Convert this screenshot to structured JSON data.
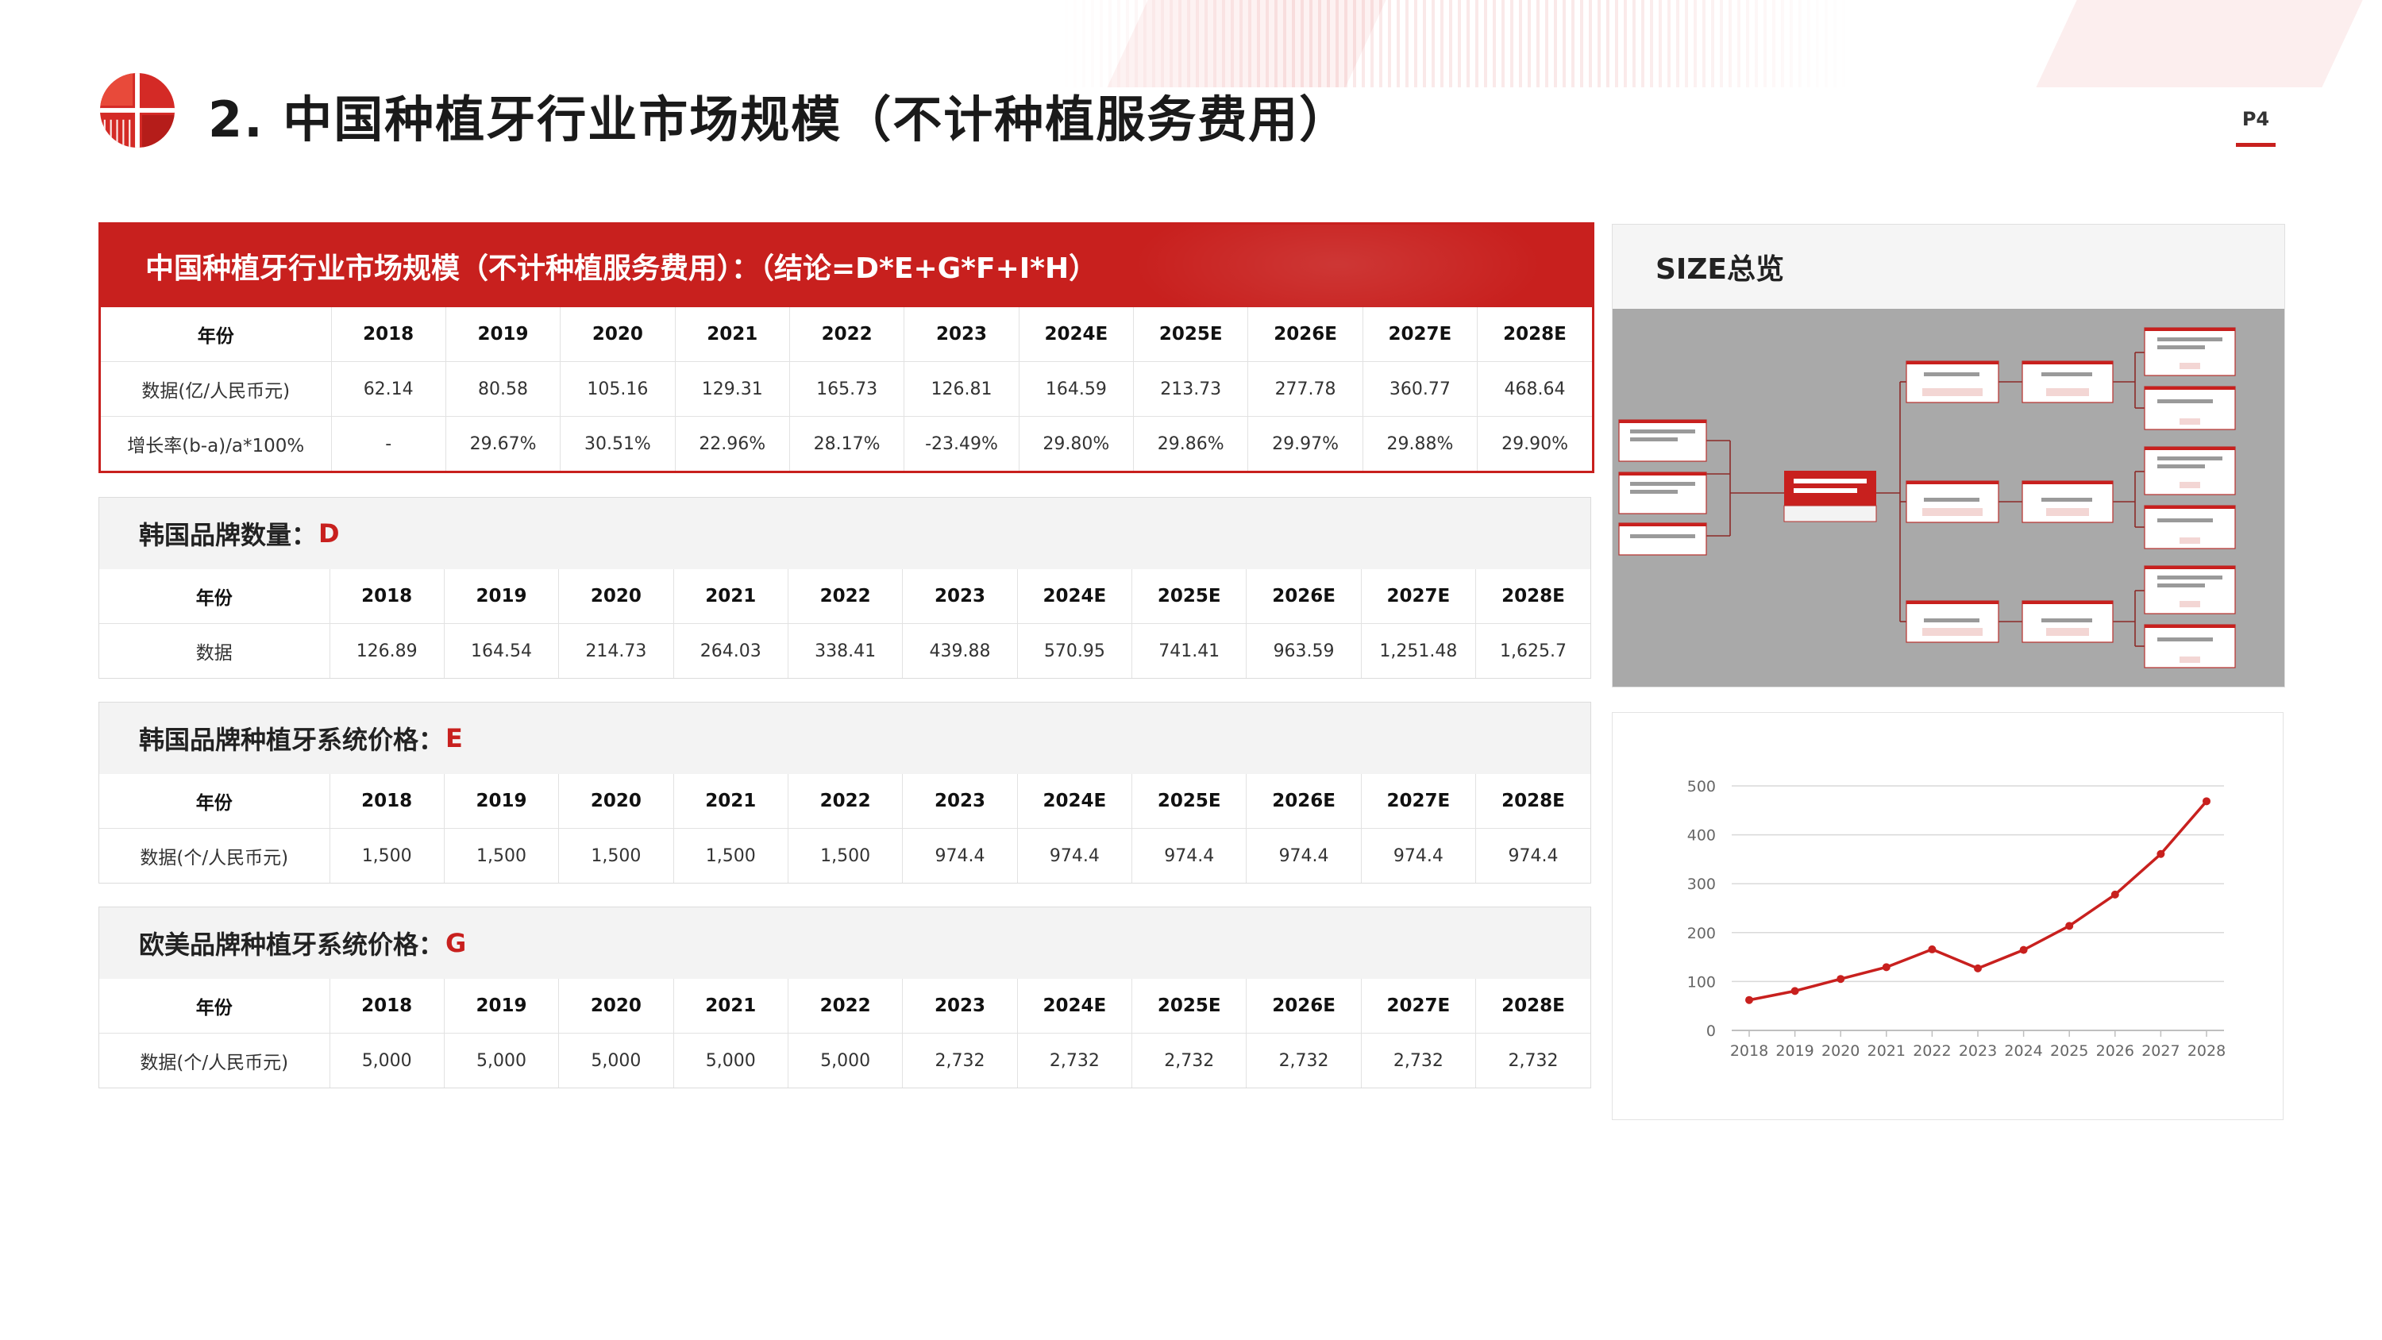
{
  "header": {
    "title": "2.  中国种植牙行业市场规模（不计种植服务费用）",
    "page_number": "P4"
  },
  "logo": {
    "name": "company-logo-icon",
    "color": "#d42a26"
  },
  "colors": {
    "accent": "#c8201e",
    "header_gray": "#f3f3f3",
    "diagram_bg": "#a9a9a9"
  },
  "main_table": {
    "title": "中国种植牙行业市场规模（不计种植服务费用）：（结论=D*E+G*F+I*H）",
    "header": [
      "年份",
      "2018",
      "2019",
      "2020",
      "2021",
      "2022",
      "2023",
      "2024E",
      "2025E",
      "2026E",
      "2027E",
      "2028E"
    ],
    "rows": [
      [
        "数据(亿/人民币元)",
        "62.14",
        "80.58",
        "105.16",
        "129.31",
        "165.73",
        "126.81",
        "164.59",
        "213.73",
        "277.78",
        "360.77",
        "468.64"
      ],
      [
        "增长率(b-a)/a*100%",
        "-",
        "29.67%",
        "30.51%",
        "22.96%",
        "28.17%",
        "-23.49%",
        "29.80%",
        "29.86%",
        "29.97%",
        "29.88%",
        "29.90%"
      ]
    ]
  },
  "sections": [
    {
      "title": "韩国品牌数量：",
      "var": "D",
      "header": [
        "年份",
        "2018",
        "2019",
        "2020",
        "2021",
        "2022",
        "2023",
        "2024E",
        "2025E",
        "2026E",
        "2027E",
        "2028E"
      ],
      "rows": [
        [
          "数据",
          "126.89",
          "164.54",
          "214.73",
          "264.03",
          "338.41",
          "439.88",
          "570.95",
          "741.41",
          "963.59",
          "1,251.48",
          "1,625.7"
        ]
      ]
    },
    {
      "title": "韩国品牌种植牙系统价格：",
      "var": "E",
      "header": [
        "年份",
        "2018",
        "2019",
        "2020",
        "2021",
        "2022",
        "2023",
        "2024E",
        "2025E",
        "2026E",
        "2027E",
        "2028E"
      ],
      "rows": [
        [
          "数据(个/人民币元)",
          "1,500",
          "1,500",
          "1,500",
          "1,500",
          "1,500",
          "974.4",
          "974.4",
          "974.4",
          "974.4",
          "974.4",
          "974.4"
        ]
      ]
    },
    {
      "title": "欧美品牌种植牙系统价格：",
      "var": "G",
      "header": [
        "年份",
        "2018",
        "2019",
        "2020",
        "2021",
        "2022",
        "2023",
        "2024E",
        "2025E",
        "2026E",
        "2027E",
        "2028E"
      ],
      "rows": [
        [
          "数据(个/人民币元)",
          "5,000",
          "5,000",
          "5,000",
          "5,000",
          "5,000",
          "2,732",
          "2,732",
          "2,732",
          "2,732",
          "2,732",
          "2,732"
        ]
      ]
    }
  ],
  "size_panel": {
    "title": "SIZE总览"
  },
  "chart_data": {
    "type": "line",
    "x": [
      "2018",
      "2019",
      "2020",
      "2021",
      "2022",
      "2023",
      "2024",
      "2025",
      "2026",
      "2027",
      "2028"
    ],
    "values": [
      62.14,
      80.58,
      105.16,
      129.31,
      165.73,
      126.81,
      164.59,
      213.73,
      277.78,
      360.77,
      468.64
    ],
    "ylim": [
      0,
      500
    ],
    "yticks": [
      0,
      100,
      200,
      300,
      400,
      500
    ],
    "grid": true,
    "color": "#c8201e"
  }
}
